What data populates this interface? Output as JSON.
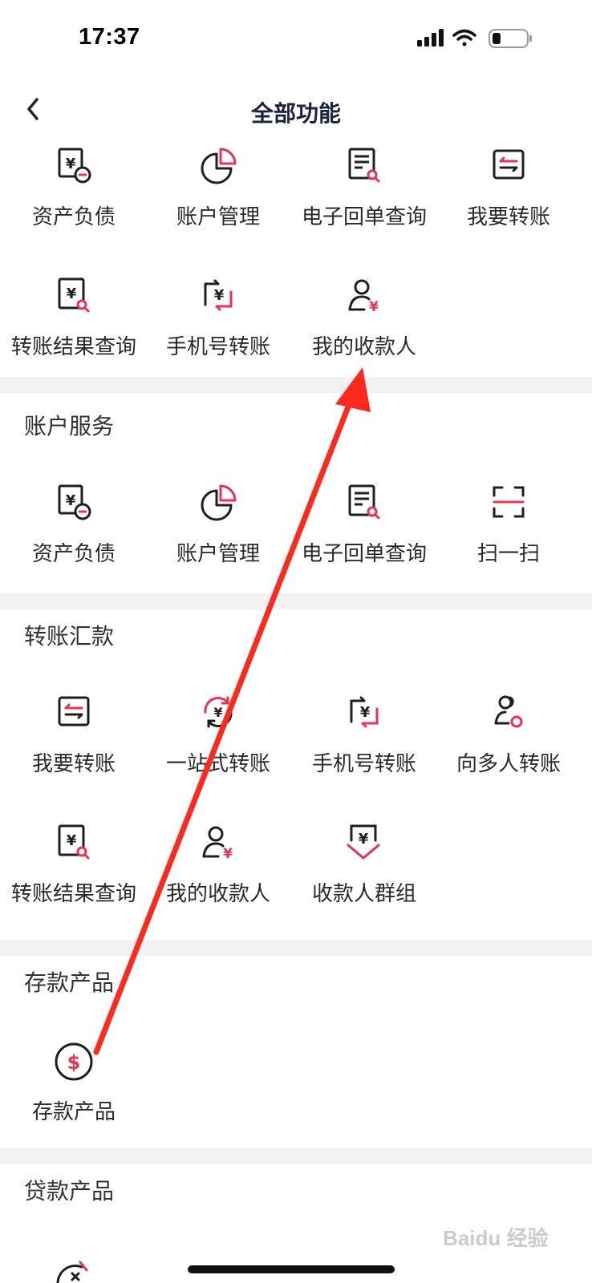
{
  "status_bar": {
    "time": "17:37"
  },
  "nav": {
    "title": "全部功能",
    "back_icon": "chevron-left-icon"
  },
  "top_section": {
    "items": [
      {
        "label": "资产负债",
        "icon": "asset-liability-icon"
      },
      {
        "label": "账户管理",
        "icon": "pie-chart-icon"
      },
      {
        "label": "电子回单查询",
        "icon": "receipt-search-icon"
      },
      {
        "label": "我要转账",
        "icon": "transfer-icon"
      },
      {
        "label": "转账结果查询",
        "icon": "transfer-result-search-icon"
      },
      {
        "label": "手机号转账",
        "icon": "phone-transfer-icon"
      },
      {
        "label": "我的收款人",
        "icon": "payee-icon"
      }
    ]
  },
  "sections": [
    {
      "title": "账户服务",
      "items": [
        {
          "label": "资产负债",
          "icon": "asset-liability-icon"
        },
        {
          "label": "账户管理",
          "icon": "pie-chart-icon"
        },
        {
          "label": "电子回单查询",
          "icon": "receipt-search-icon"
        },
        {
          "label": "扫一扫",
          "icon": "scan-icon"
        }
      ]
    },
    {
      "title": "转账汇款",
      "items": [
        {
          "label": "我要转账",
          "icon": "transfer-icon"
        },
        {
          "label": "一站式转账",
          "icon": "one-stop-transfer-icon"
        },
        {
          "label": "手机号转账",
          "icon": "phone-transfer-icon"
        },
        {
          "label": "向多人转账",
          "icon": "multi-payee-transfer-icon"
        },
        {
          "label": "转账结果查询",
          "icon": "transfer-result-search-icon"
        },
        {
          "label": "我的收款人",
          "icon": "payee-icon"
        },
        {
          "label": "收款人群组",
          "icon": "payee-group-icon"
        }
      ]
    },
    {
      "title": "存款产品",
      "items": [
        {
          "label": "存款产品",
          "icon": "deposit-coin-icon"
        }
      ]
    },
    {
      "title": "贷款产品",
      "items": []
    }
  ],
  "watermark": "Baidu 经验",
  "colors": {
    "accent_red": "#e8344e",
    "icon_dark": "#1f1f1f",
    "title_navy": "#1b2340",
    "section_gap": "#f2f2f4",
    "annotation_arrow": "#ff2a1e"
  }
}
